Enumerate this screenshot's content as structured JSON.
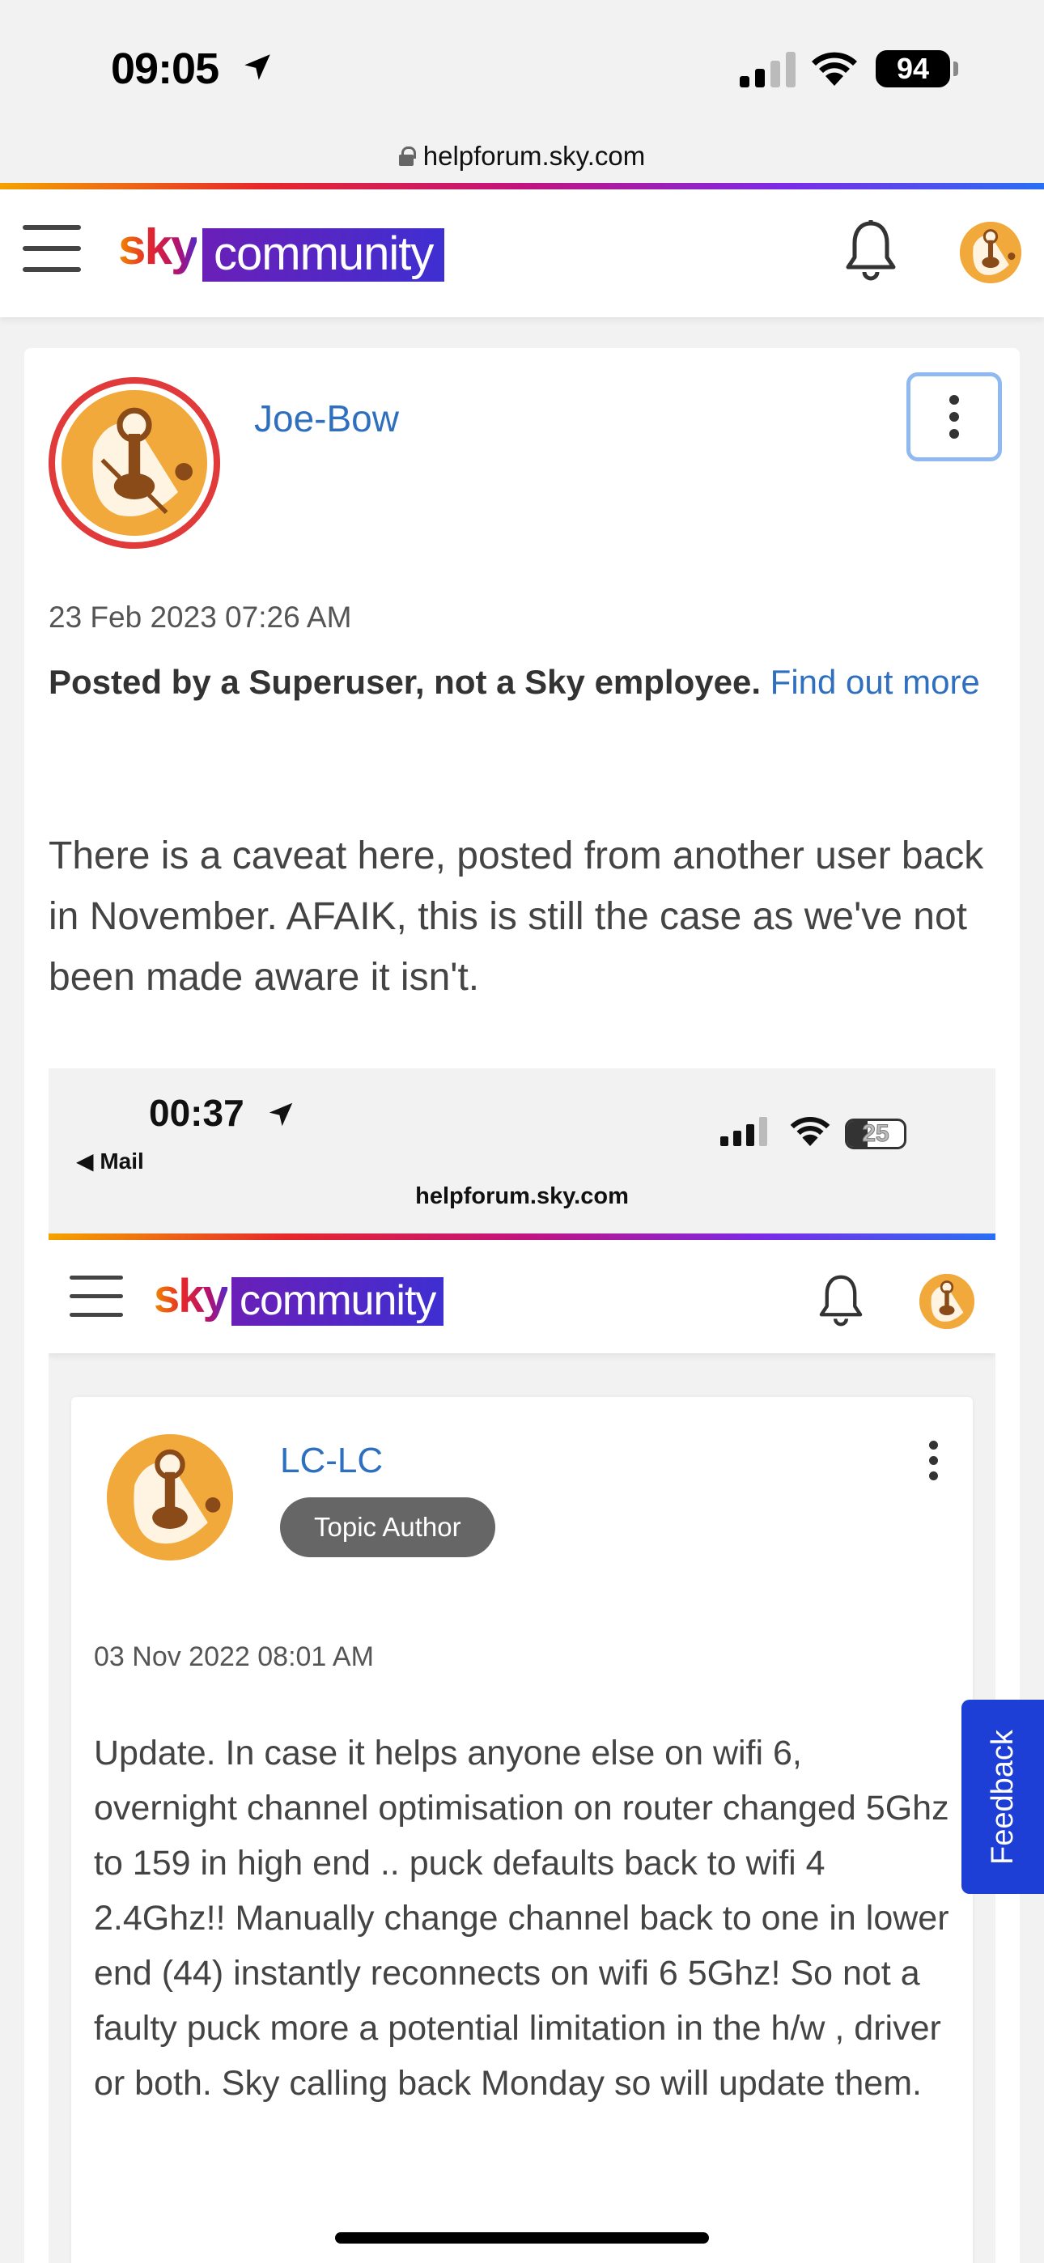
{
  "status_bar": {
    "time": "09:05",
    "battery": "94"
  },
  "browser": {
    "url": "helpforum.sky.com"
  },
  "header": {
    "logo_sky": "sky",
    "logo_community": "community"
  },
  "post": {
    "author": "Joe-Bow",
    "date": "23 Feb 2023 07:26 AM",
    "disclaimer_bold": "Posted by a Superuser, not a Sky employee.",
    "disclaimer_link": "Find out more",
    "body": "There is a caveat here, posted from another user back in November.  AFAIK, this is still the case as we've not been made aware it isn't."
  },
  "embedded_screenshot": {
    "time": "00:37",
    "back_label": "◀ Mail",
    "battery": "25",
    "url": "helpforum.sky.com",
    "logo_sky": "sky",
    "logo_community": "community",
    "author": "LC-LC",
    "badge": "Topic Author",
    "date": "03 Nov 2022 08:01 AM",
    "body": "Update. In case it helps anyone else on wifi 6, overnight channel optimisation on router changed 5Ghz to 159 in high end .. puck defaults back to wifi 4 2.4Ghz!! Manually change channel back to one in lower end (44) instantly reconnects on wifi 6 5Ghz! So not a faulty puck more a potential limitation in the h/w , driver or both. Sky calling back Monday so will update them."
  },
  "feedback_tab": {
    "label": "Feedback"
  },
  "colors": {
    "link": "#2f6fbf",
    "feedback_bg": "#1d3fd6",
    "avatar_ring": "#e03a3a",
    "badge_bg": "#666666"
  }
}
